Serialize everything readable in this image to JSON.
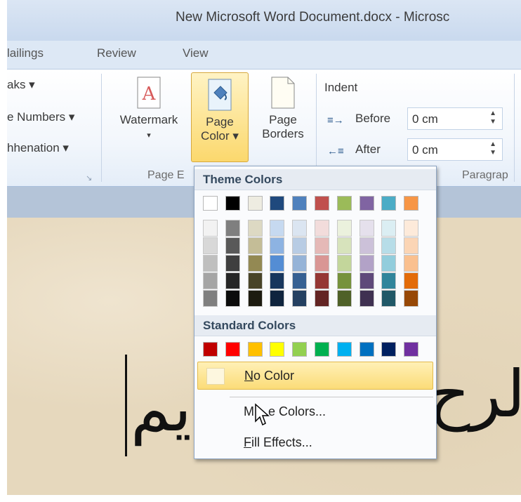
{
  "window": {
    "title": "New Microsoft Word Document.docx - Microsc"
  },
  "tabs": [
    "lailings",
    "Review",
    "View"
  ],
  "ribbon": {
    "left_items": [
      "aks ▾",
      "e Numbers ▾",
      "hhenation ▾"
    ],
    "watermark": {
      "line1": "Watermark",
      "line2": "▾"
    },
    "page_color": {
      "line1": "Page",
      "line2": "Color ▾"
    },
    "page_borders": {
      "line1": "Page",
      "line2": "Borders"
    },
    "indent": {
      "title": "Indent",
      "before_label": "Before",
      "before_value": "0 cm",
      "after_label": "After",
      "after_value": "0 cm"
    },
    "group_labels": {
      "page_background": "Page E",
      "paragraph": "Paragrap"
    }
  },
  "dropdown": {
    "theme_title": "Theme Colors",
    "standard_title": "Standard Colors",
    "no_color": "No Color",
    "more_colors": "M    e Colors...",
    "fill_effects": "Fill Effects...",
    "theme_top_colors": [
      "#ffffff",
      "#000000",
      "#eeece1",
      "#1f497d",
      "#4f81bd",
      "#c0504d",
      "#9bbb59",
      "#8064a2",
      "#4bacc6",
      "#f79646"
    ],
    "theme_shades": [
      [
        "#f2f2f2",
        "#d8d8d8",
        "#bfbfbf",
        "#a5a5a5",
        "#7f7f7f"
      ],
      [
        "#7f7f7f",
        "#595959",
        "#3f3f3f",
        "#262626",
        "#0c0c0c"
      ],
      [
        "#ddd9c3",
        "#c4bd97",
        "#938953",
        "#494429",
        "#1d1b10"
      ],
      [
        "#c6d9f0",
        "#8db3e2",
        "#548dd4",
        "#17365d",
        "#0f243e"
      ],
      [
        "#dbe5f1",
        "#b8cce4",
        "#95b3d7",
        "#366092",
        "#244061"
      ],
      [
        "#f2dcdb",
        "#e5b9b7",
        "#d99694",
        "#953734",
        "#632423"
      ],
      [
        "#ebf1dd",
        "#d7e3bc",
        "#c3d69b",
        "#76923c",
        "#4f6128"
      ],
      [
        "#e5e0ec",
        "#ccc1d9",
        "#b2a2c7",
        "#5f497a",
        "#3f3151"
      ],
      [
        "#dbeef3",
        "#b7dde8",
        "#92cddc",
        "#31859b",
        "#205867"
      ],
      [
        "#fdeada",
        "#fbd5b5",
        "#fac08f",
        "#e36c09",
        "#974806"
      ]
    ],
    "standard_colors": [
      "#c00000",
      "#ff0000",
      "#ffc000",
      "#ffff00",
      "#92d050",
      "#00b050",
      "#00b0f0",
      "#0070c0",
      "#002060",
      "#7030a0"
    ]
  },
  "document": {
    "arabic_left": "يم",
    "arabic_middle": "حيم",
    "arabic_right": "لرح"
  }
}
